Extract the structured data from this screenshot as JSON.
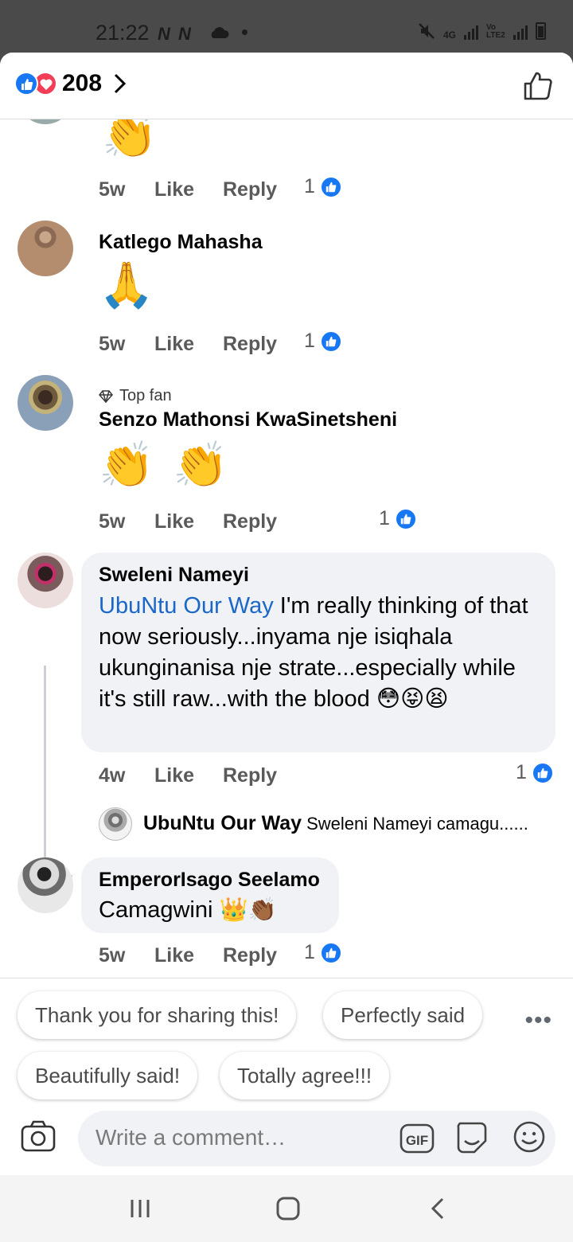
{
  "status_bar": {
    "time": "21:22",
    "left_icons": "N N",
    "network_4g": "4G",
    "network_volte": "Vo LTE2"
  },
  "header": {
    "reaction_count": "208"
  },
  "comments": [
    {
      "time": "5w",
      "like_label": "Like",
      "reply_label": "Reply",
      "likes": "1",
      "emoji": "👏"
    },
    {
      "name": "Katlego Mahasha",
      "emoji": "🙏",
      "time": "5w",
      "like_label": "Like",
      "reply_label": "Reply",
      "likes": "1"
    },
    {
      "badge": "Top fan",
      "name": "Senzo Mathonsi KwaSinetsheni",
      "emoji": "👏 👏",
      "time": "5w",
      "like_label": "Like",
      "reply_label": "Reply",
      "likes": "1"
    },
    {
      "name": "Sweleni Nameyi",
      "mention": "UbuNtu Our Way",
      "text": " I'm really thinking of that now seriously...inyama nje isiqhala ukunginanisa nje strate...especially while it's still raw...with the blood 😳😝😫",
      "time": "4w",
      "like_label": "Like",
      "reply_label": "Reply",
      "likes": "1",
      "reply_preview": {
        "name": "UbuNtu Our Way",
        "text": "Sweleni Nameyi camagu......"
      }
    },
    {
      "name": "EmperorIsago Seelamo",
      "text": "Camagwini 👑👏🏾",
      "time": "5w",
      "like_label": "Like",
      "reply_label": "Reply",
      "likes": "1"
    }
  ],
  "quick_replies": [
    "Thank you for sharing this!",
    "Perfectly said",
    "Beautifully said!",
    "Totally agree!!!"
  ],
  "more_label": "•••",
  "composer": {
    "placeholder": "Write a comment…",
    "gif_label": "GIF"
  },
  "colors": {
    "accent": "#1877f2",
    "love": "#f33e58",
    "bubble": "#f0f2f5",
    "mention": "#1a67c8"
  }
}
